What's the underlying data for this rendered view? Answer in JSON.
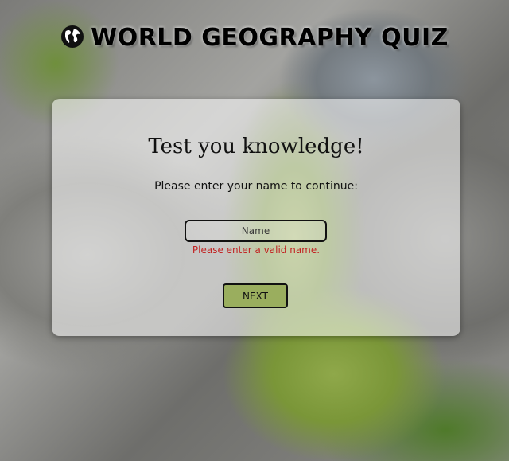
{
  "app": {
    "title": "WORLD GEOGRAPHY QUIZ",
    "title_icon": "globe-icon"
  },
  "card": {
    "heading": "Test you knowledge!",
    "prompt": "Please enter your name to continue:",
    "name_input": {
      "value": "",
      "placeholder": "Name"
    },
    "error_message": "Please enter a valid name.",
    "next_label": "NEXT"
  },
  "colors": {
    "error": "#c22222",
    "next_button": "#9aae5e"
  }
}
